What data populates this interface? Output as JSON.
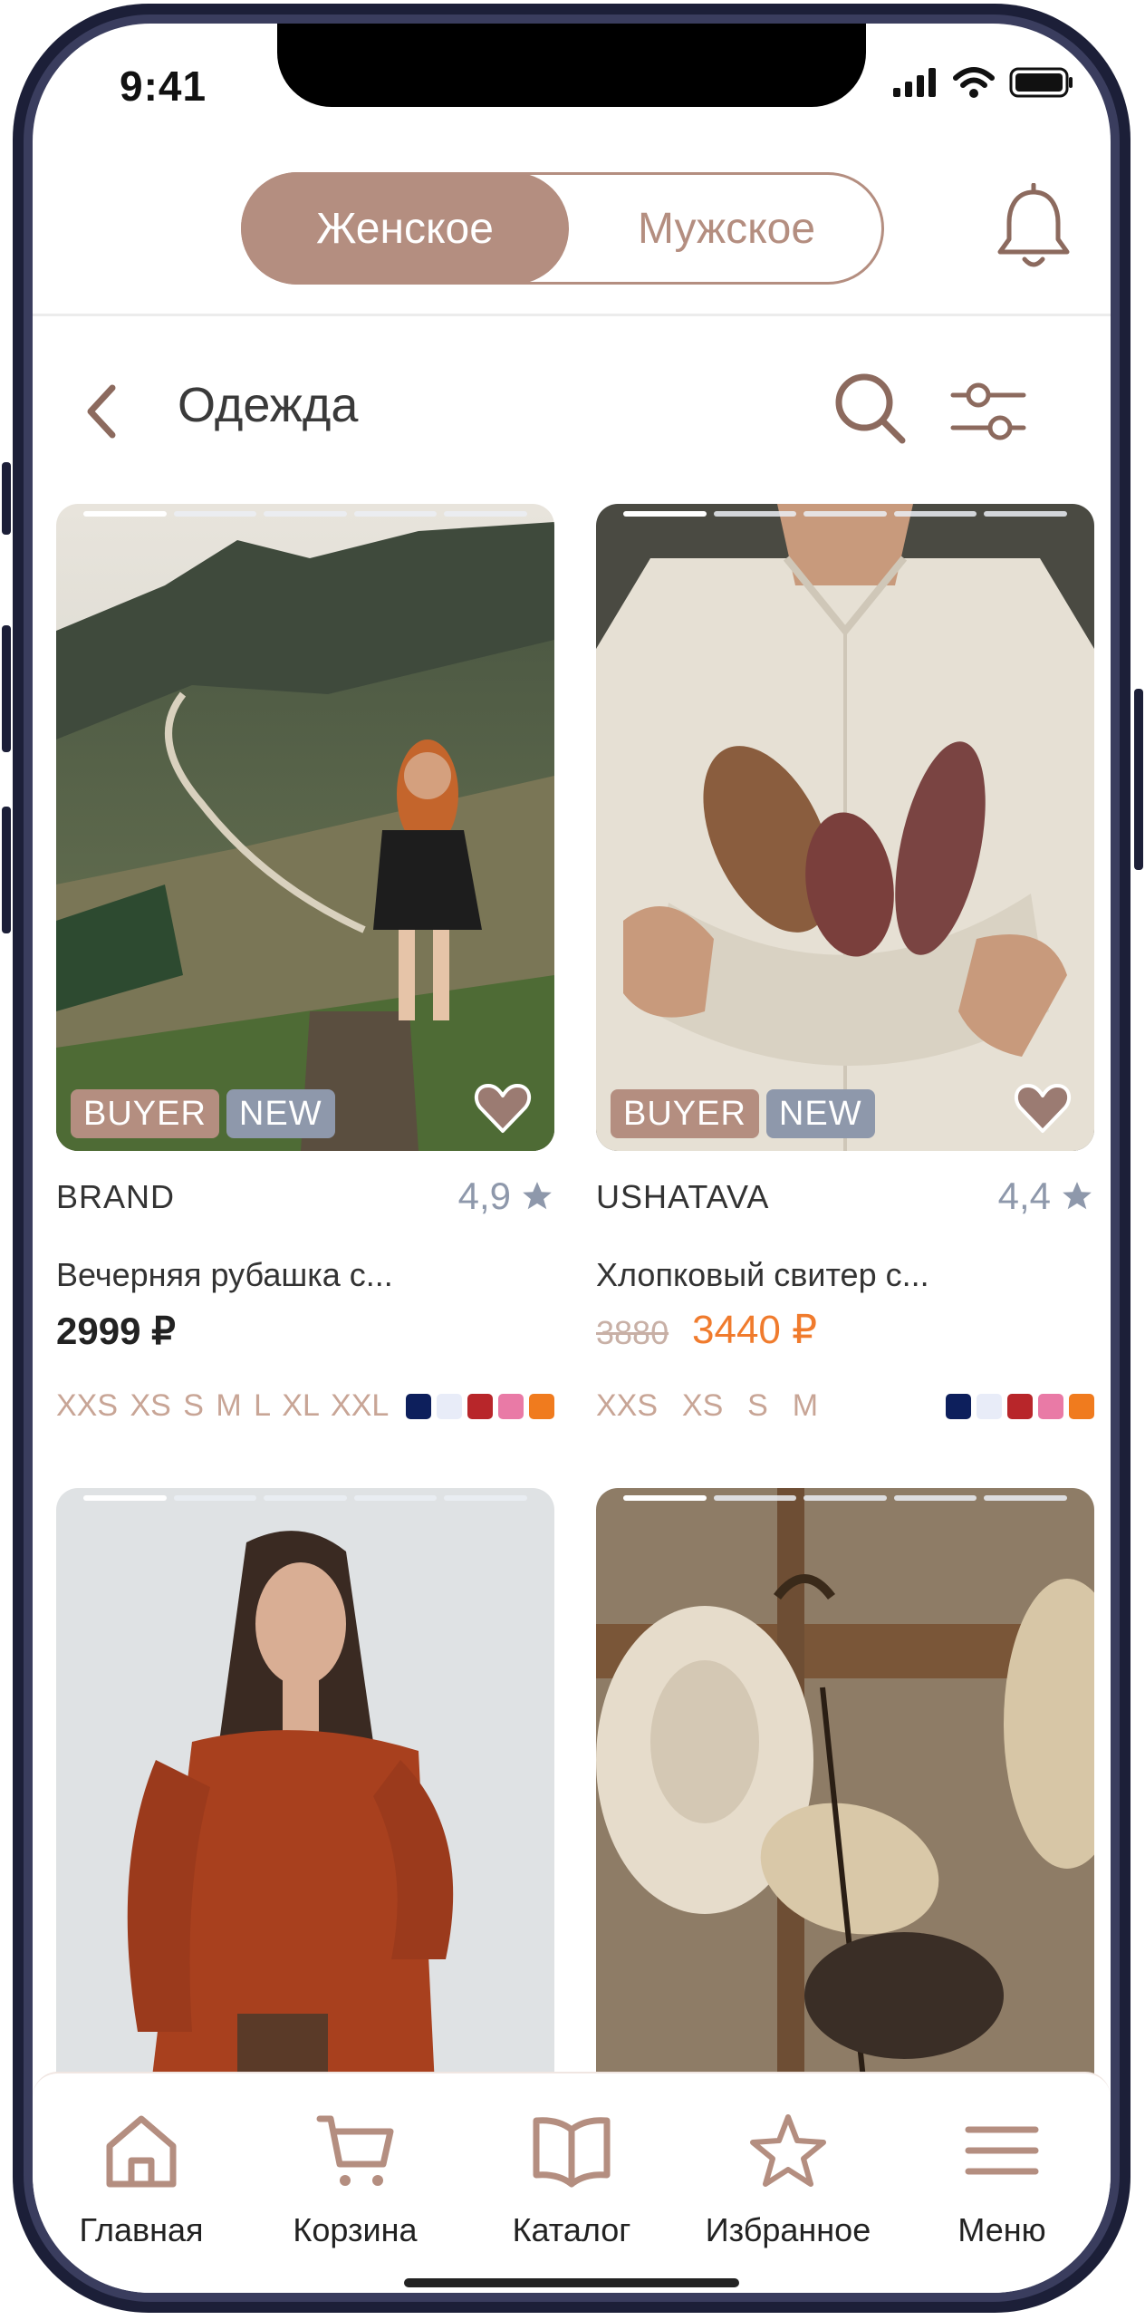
{
  "status_bar": {
    "time": "9:41"
  },
  "header": {
    "tabs": [
      {
        "label": "Женское",
        "active": true
      },
      {
        "label": "Мужское",
        "active": false
      }
    ],
    "icons": [
      "bell-icon"
    ]
  },
  "toolbar": {
    "title": "Одежда",
    "icons": [
      "back-chevron-icon",
      "search-icon",
      "filter-sliders-icon"
    ]
  },
  "colors": {
    "accent": "#b48e80",
    "badge_new": "#8e98ab",
    "sale_price": "#f07b2d"
  },
  "products": [
    {
      "brand": "BRAND",
      "rating": "4,9",
      "name": "Вечерняя рубашка с...",
      "price": "2999 ₽",
      "badges": [
        "BUYER",
        "NEW"
      ],
      "sizes": "XXS XS S M L XL XXL",
      "colors": [
        "#0d1f5c",
        "#e8ecf8",
        "#b8262a",
        "#e97aa6",
        "#f07b1e"
      ]
    },
    {
      "brand": "USHATAVA",
      "rating": "4,4",
      "name": "Хлопковый свитер с...",
      "old_price": "3880",
      "price": "3440 ₽",
      "badges": [
        "BUYER",
        "NEW"
      ],
      "sizes": "XXS  XS  S  M",
      "colors": [
        "#0d1f5c",
        "#e8ecf8",
        "#b8262a",
        "#e97aa6",
        "#f07b1e"
      ]
    }
  ],
  "nav": [
    {
      "label": "Главная",
      "icon": "home-icon"
    },
    {
      "label": "Корзина",
      "icon": "cart-icon"
    },
    {
      "label": "Каталог",
      "icon": "book-icon"
    },
    {
      "label": "Избранное",
      "icon": "star-icon"
    },
    {
      "label": "Меню",
      "icon": "menu-icon"
    }
  ]
}
